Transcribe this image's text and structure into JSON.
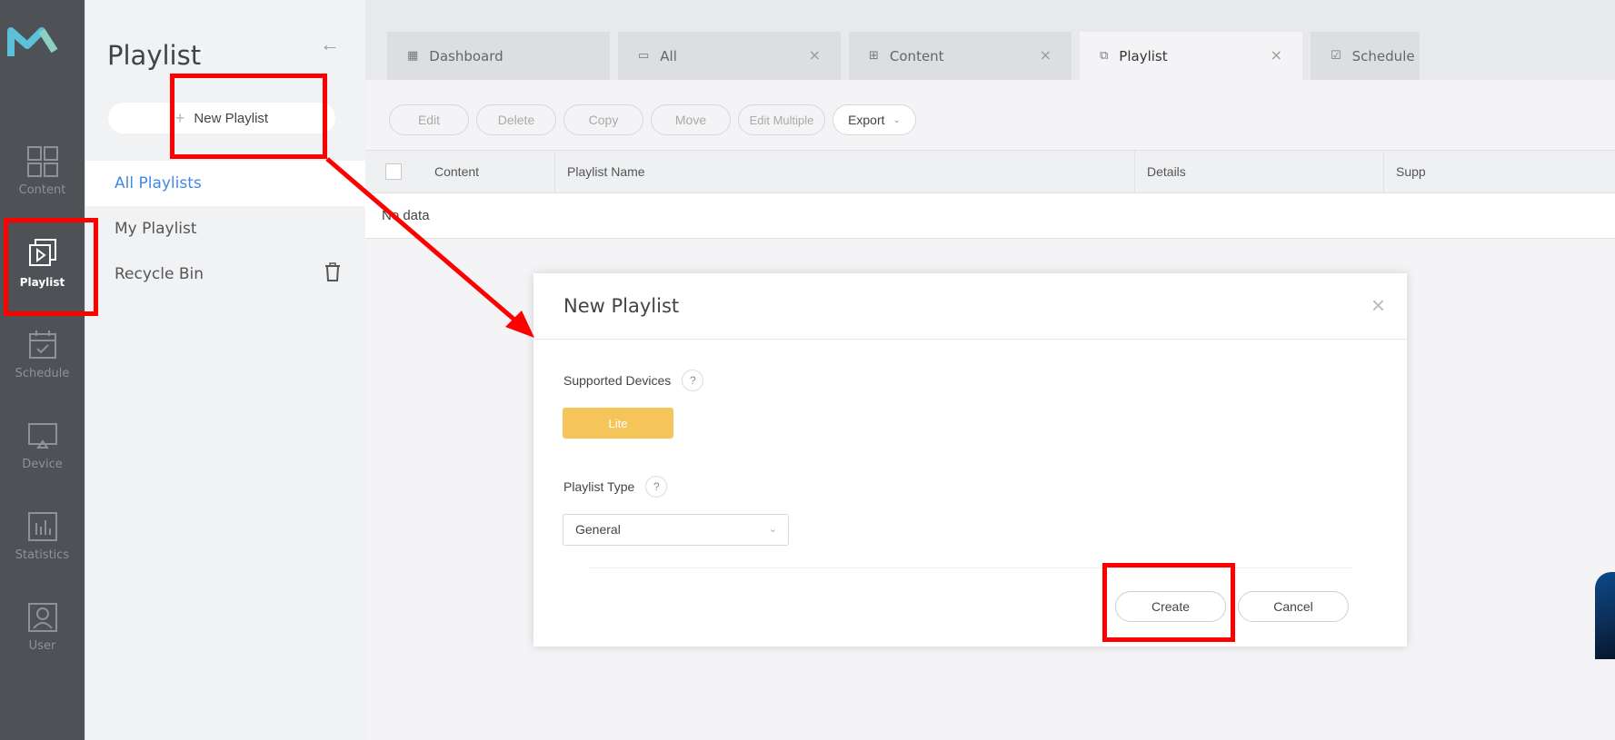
{
  "rail": {
    "items": [
      {
        "label": "Content",
        "icon": "content-grid-icon"
      },
      {
        "label": "Playlist",
        "icon": "playlist-icon",
        "active": true
      },
      {
        "label": "Schedule",
        "icon": "calendar-icon"
      },
      {
        "label": "Device",
        "icon": "monitor-icon"
      },
      {
        "label": "Statistics",
        "icon": "bar-chart-icon"
      },
      {
        "label": "User",
        "icon": "user-icon"
      }
    ]
  },
  "sidebar": {
    "title": "Playlist",
    "new_button": "New Playlist",
    "items": [
      {
        "label": "All Playlists"
      },
      {
        "label": "My Playlist"
      },
      {
        "label": "Recycle Bin"
      }
    ]
  },
  "tabs": [
    {
      "label": "Dashboard"
    },
    {
      "label": "All"
    },
    {
      "label": "Content"
    },
    {
      "label": "Playlist"
    },
    {
      "label": "Schedule"
    }
  ],
  "toolbar": {
    "edit": "Edit",
    "delete": "Delete",
    "copy": "Copy",
    "move": "Move",
    "edit_multiple": "Edit Multiple",
    "export": "Export"
  },
  "table": {
    "columns": [
      "Content",
      "Playlist Name",
      "Details",
      "Supp"
    ],
    "empty": "No data"
  },
  "modal": {
    "title": "New Playlist",
    "supported_devices_label": "Supported Devices",
    "lite": "Lite",
    "playlist_type_label": "Playlist Type",
    "playlist_type_value": "General",
    "create": "Create",
    "cancel": "Cancel"
  },
  "colors": {
    "accent": "#3e8ae6",
    "lite": "#f5c55a",
    "highlight": "#ff0000"
  }
}
